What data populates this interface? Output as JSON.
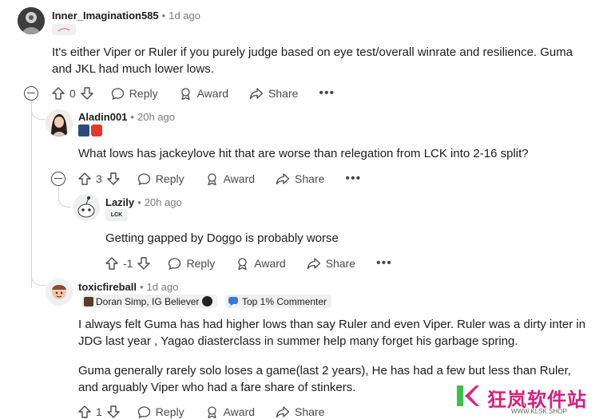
{
  "comments": [
    {
      "username": "Inner_Imagination585",
      "time": "1d ago",
      "body": "It's either Viper or Ruler if you purely judge based on eye test/overall winrate and resilience. Guma and JKL had much lower lows.",
      "votes": "0",
      "reply": "Reply",
      "award": "Award",
      "share": "Share"
    },
    {
      "username": "Aladin001",
      "time": "20h ago",
      "body": "What lows has jackeylove hit that are worse than relegation from LCK into 2-16 split?",
      "votes": "3",
      "reply": "Reply",
      "award": "Award",
      "share": "Share"
    },
    {
      "username": "Lazily",
      "time": "20h ago",
      "body": "Getting gapped by Doggo is probably worse",
      "votes": "-1",
      "reply": "Reply",
      "award": "Award",
      "share": "Share",
      "flair": "LCK"
    },
    {
      "username": "toxicfireball",
      "time": "1d ago",
      "flair_text": "Doran Simp, IG Believer",
      "badge": "Top 1% Commenter",
      "body1": "I always felt Guma has had higher lows than say Ruler and even Viper. Ruler was a dirty inter in JDG last year , Yagao diasterclass in summer help many forget his garbage spring.",
      "body2": "Guma generally rarely solo loses a game(last 2 years), He has had a few but less than Ruler, and arguably Viper who had a fare share of stinkers.",
      "votes": "1",
      "reply": "Reply",
      "award": "Award",
      "share": "Share"
    }
  ],
  "more_label": "•••",
  "watermark": {
    "title": "狂岚软件站",
    "url": "WWW.KLSK.SHOP",
    "color": "#d81e7c"
  },
  "icons": [
    "upvote-icon",
    "downvote-icon",
    "reply-icon",
    "award-icon",
    "share-icon",
    "more-icon",
    "collapse-icon"
  ]
}
